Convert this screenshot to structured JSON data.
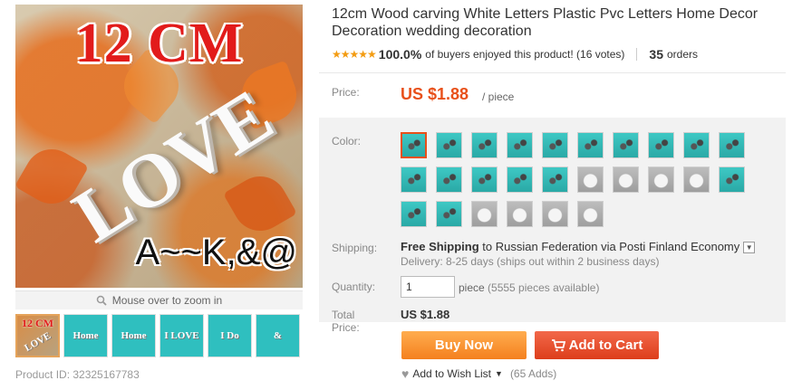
{
  "gallery": {
    "main_image": {
      "title_text": "12 CM",
      "love_text": "LOVE",
      "caption_text": "A~~K,&@"
    },
    "zoom_hint": "Mouse over to zoom in",
    "thumbnails": [
      {
        "label": "12 CM",
        "sub": "LOVE"
      },
      {
        "label": "",
        "sub": "Home"
      },
      {
        "label": "",
        "sub": "Home"
      },
      {
        "label": "",
        "sub": "I LOVE"
      },
      {
        "label": "",
        "sub": "I Do"
      },
      {
        "label": "",
        "sub": "&"
      }
    ],
    "product_id": "Product ID: 32325167783"
  },
  "product": {
    "title": "12cm Wood carving White Letters Plastic Pvc Letters Home Decor Decoration wedding decoration",
    "rating": {
      "stars": 5,
      "percent": "100.0%",
      "text": "of buyers enjoyed this product! (16 votes)"
    },
    "orders": {
      "count": "35",
      "label": "orders"
    }
  },
  "price": {
    "label": "Price:",
    "value": "US $1.88",
    "unit": "/ piece"
  },
  "color": {
    "label": "Color:",
    "swatch_count": 26,
    "selected_index": 0,
    "gray_indices": [
      15,
      16,
      17,
      18,
      22,
      23,
      24,
      25
    ]
  },
  "shipping": {
    "label": "Shipping:",
    "free_text": "Free Shipping",
    "to_text": " to Russian Federation via Posti Finland Economy",
    "delivery": "Delivery: 8-25 days (ships out within 2 business days)"
  },
  "quantity": {
    "label": "Quantity:",
    "value": "1",
    "unit": "piece",
    "available": "(5555 pieces available)"
  },
  "total": {
    "label": "Total Price:",
    "value": "US $1.88"
  },
  "actions": {
    "buy_now": "Buy Now",
    "add_to_cart": "Add to Cart",
    "wishlist": "Add to Wish List",
    "wishlist_count": "(65 Adds)"
  }
}
